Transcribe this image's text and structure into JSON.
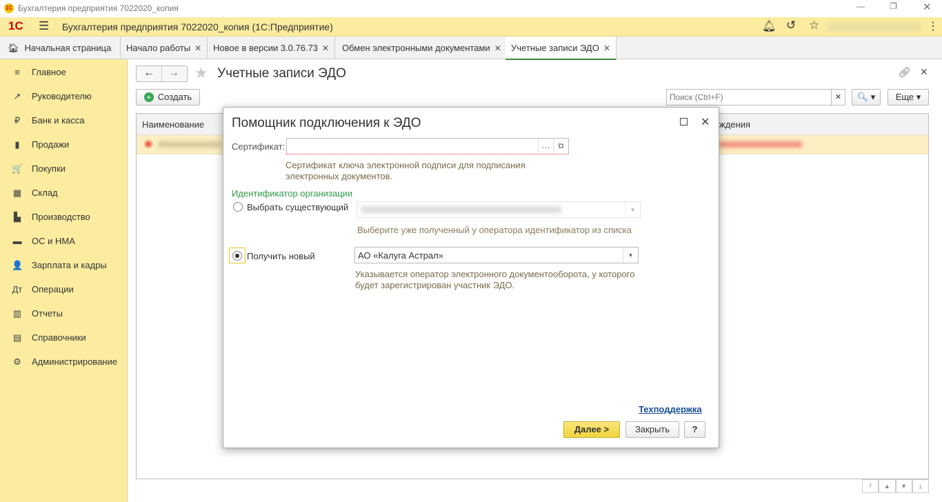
{
  "window": {
    "title": "Бухгалтерия предприятия 7022020_копия"
  },
  "appbar": {
    "title": "Бухгалтерия предприятия 7022020_копия  (1С:Предприятие)"
  },
  "tabs": [
    {
      "label": "Начальная страница"
    },
    {
      "label": "Начало работы"
    },
    {
      "label": "Новое в версии 3.0.76.73"
    },
    {
      "label": "Обмен электронными документами"
    },
    {
      "label": "Учетные записи ЭДО"
    }
  ],
  "sidebar": {
    "items": [
      {
        "label": "Главное",
        "icon": "≡"
      },
      {
        "label": "Руководителю",
        "icon": "↗"
      },
      {
        "label": "Банк и касса",
        "icon": "₽"
      },
      {
        "label": "Продажи",
        "icon": "▮"
      },
      {
        "label": "Покупки",
        "icon": "🛒"
      },
      {
        "label": "Склад",
        "icon": "▦"
      },
      {
        "label": "Производство",
        "icon": "▙"
      },
      {
        "label": "ОС и НМА",
        "icon": "▬"
      },
      {
        "label": "Зарплата и кадры",
        "icon": "👤"
      },
      {
        "label": "Операции",
        "icon": "Дт"
      },
      {
        "label": "Отчеты",
        "icon": "▥"
      },
      {
        "label": "Справочники",
        "icon": "▤"
      },
      {
        "label": "Администрирование",
        "icon": "⚙"
      }
    ]
  },
  "page": {
    "title": "Учетные записи ЭДО",
    "create_label": "Создать",
    "search_placeholder": "Поиск (Ctrl+F)",
    "more_label": "Еще",
    "columns": [
      "Наименование",
      "ждения"
    ]
  },
  "dialog": {
    "title": "Помощник подключения к ЭДО",
    "cert_label": "Сертификат:",
    "cert_hint": "Сертификат ключа электронной подписи для подписания электронных документов.",
    "org_id_heading": "Идентификатор организации",
    "opt_existing": "Выбрать существующий",
    "existing_hint": "Выберите уже полученный у оператора идентификатор из списка",
    "opt_new": "Получить новый",
    "operator_value": "АО «Калуга Астрал»",
    "operator_hint": "Указывается оператор электронного документооборота, у которого будет зарегистрирован участник ЭДО.",
    "support_link": "Техподдержка",
    "next_label": "Далее >",
    "close_label": "Закрыть",
    "help_label": "?"
  }
}
